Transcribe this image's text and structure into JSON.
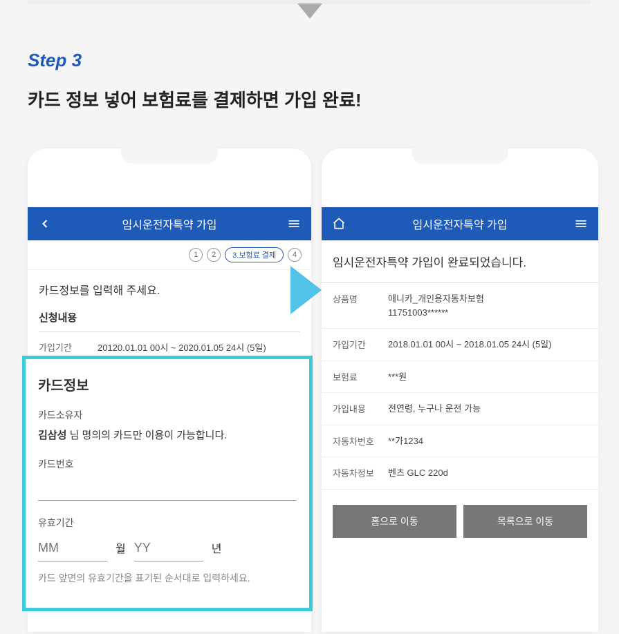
{
  "step_label": "Step 3",
  "step_title": "카드 정보 넣어 보험료를 결제하면 가입 완료!",
  "left_phone": {
    "header_title": "임시운전자특약 가입",
    "steps": {
      "s1": "1",
      "s2": "2",
      "s3": "3.보험료 결제",
      "s4": "4"
    },
    "instruction": "카드정보를 입력해 주세요.",
    "section_title": "신청내용",
    "period_label": "가입기간",
    "period_value": "20120.01.01 00시 ~ 2020.01.05 24시 (5일)"
  },
  "card_box": {
    "title": "카드정보",
    "owner_label": "카드소유자",
    "owner_name": "김삼성",
    "owner_suffix": " 님 명의의 카드만 이용이 가능합니다.",
    "number_label": "카드번호",
    "expiry_label": "유효기간",
    "mm_placeholder": "MM",
    "month_unit": "월",
    "yy_placeholder": "YY",
    "year_unit": "년",
    "helper": "카드 앞면의 유효기간을 표기된 순서대로 입력하세요."
  },
  "right_phone": {
    "header_title": "임시운전자특약 가입",
    "complete_text": "임시운전자특약 가입이 완료되었습니다.",
    "rows": {
      "product_label": "상품명",
      "product_value": "애니카_개인용자동차보험\n11751003******",
      "period_label": "가입기간",
      "period_value": "2018.01.01 00시 ~ 2018.01.05 24시 (5일)",
      "fee_label": "보험료",
      "fee_value": "***원",
      "content_label": "가입내용",
      "content_value": "전연령, 누구나 운전 가능",
      "carnum_label": "자동차번호",
      "carnum_value": "**가1234",
      "carinfo_label": "자동차정보",
      "carinfo_value": "벤츠 GLC 220d"
    },
    "home_button": "홈으로 이동",
    "list_button": "목록으로 이동"
  }
}
